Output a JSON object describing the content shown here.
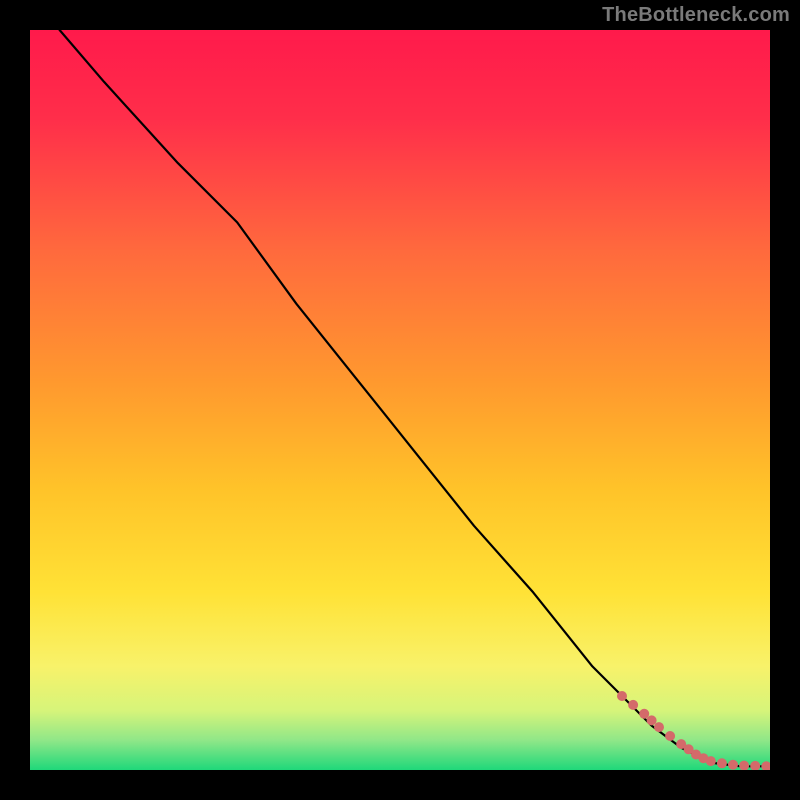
{
  "watermark": "TheBottleneck.com",
  "chart_data": {
    "type": "line",
    "title": "",
    "xlabel": "",
    "ylabel": "",
    "xlim": [
      0,
      100
    ],
    "ylim": [
      0,
      100
    ],
    "grid": false,
    "legend": false,
    "background": {
      "top_color": "#ff1a4b",
      "mid_color": "#ffde33",
      "bottom_color": "#1fd87a",
      "note": "vertical gradient red→orange→yellow→green"
    },
    "series": [
      {
        "name": "curve",
        "color": "#000000",
        "stroke_width": 2,
        "x": [
          4,
          10,
          20,
          28,
          36,
          44,
          52,
          60,
          68,
          76,
          84,
          88,
          92,
          96,
          100
        ],
        "y": [
          100,
          93,
          82,
          74,
          63,
          53,
          43,
          33,
          24,
          14,
          6,
          3,
          1,
          0.5,
          0.5
        ]
      },
      {
        "name": "markers",
        "type": "scatter",
        "color": "#d46a6a",
        "marker_radius": 5,
        "x": [
          80,
          81.5,
          83,
          84,
          85,
          86.5,
          88,
          89,
          90,
          91,
          92,
          93.5,
          95,
          96.5,
          98,
          99.5
        ],
        "y": [
          10,
          8.8,
          7.6,
          6.7,
          5.8,
          4.6,
          3.5,
          2.8,
          2.1,
          1.6,
          1.2,
          0.9,
          0.7,
          0.6,
          0.55,
          0.5
        ]
      }
    ]
  }
}
